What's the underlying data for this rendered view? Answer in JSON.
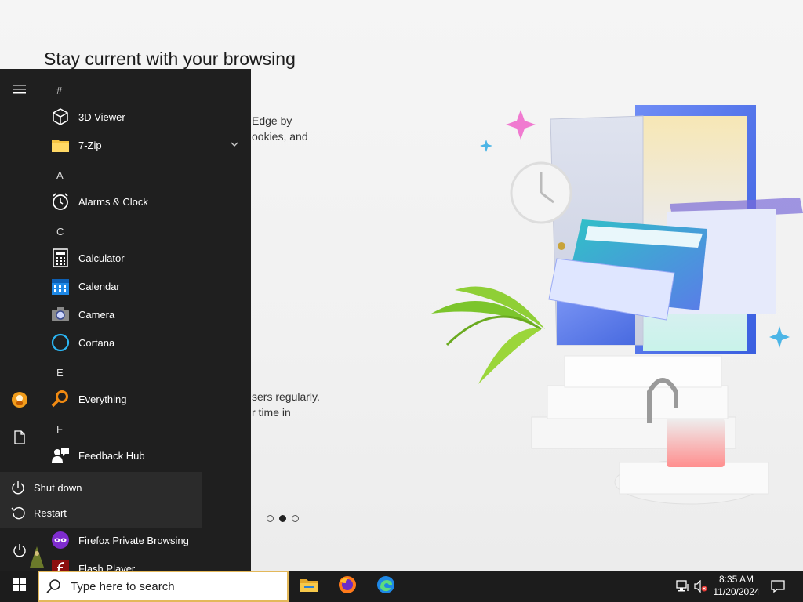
{
  "edge_page": {
    "heading": "Stay current with your browsing",
    "text_lines_top": [
      "Edge by",
      "ookies, and"
    ],
    "text_lines_bottom": [
      "sers regularly.",
      "r time in"
    ],
    "carousel": {
      "count": 3,
      "active_index": 1
    }
  },
  "start_menu": {
    "letters": {
      "hash": "#",
      "a": "A",
      "c": "C",
      "e": "E",
      "f": "F"
    },
    "apps": {
      "viewer3d": "3D Viewer",
      "zip7": "7-Zip",
      "alarms": "Alarms & Clock",
      "calculator": "Calculator",
      "calendar": "Calendar",
      "camera": "Camera",
      "cortana": "Cortana",
      "everything": "Everything",
      "feedback": "Feedback Hub",
      "firefox_private": "Firefox Private Browsing",
      "flash": "Flash Player"
    },
    "power_menu": {
      "shutdown": "Shut down",
      "restart": "Restart"
    }
  },
  "taskbar": {
    "search_placeholder": "Type here to search",
    "time": "8:35 AM",
    "date": "11/20/2024"
  },
  "colors": {
    "accent_search_border": "#e3b85a",
    "start_bg": "#1f1f1f",
    "taskbar_bg": "#1c1c1c"
  }
}
